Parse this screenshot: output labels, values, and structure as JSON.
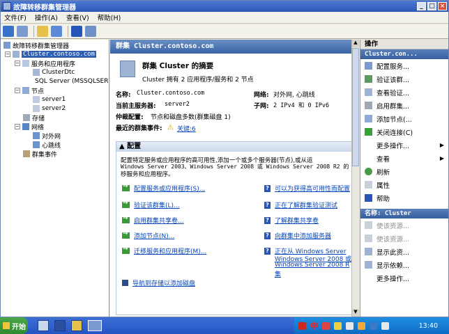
{
  "window": {
    "title": "故障转移群集管理器",
    "minimize": "_",
    "maximize": "□",
    "close": "×"
  },
  "menu": [
    "文件(F)",
    "操作(A)",
    "查看(V)",
    "帮助(H)"
  ],
  "tree": {
    "root": "故障转移群集管理器",
    "cluster": "Cluster.contoso.com",
    "services": "服务和应用程序",
    "svc1": "ClusterDtc",
    "svc2": "SQL Server (MSSQLSERVER)",
    "nodes": "节点",
    "node1": "server1",
    "node2": "server2",
    "storage": "存储",
    "networks": "网络",
    "net1": "对外网",
    "net2": "心跳线",
    "events": "群集事件"
  },
  "center": {
    "header": "群集 Cluster.contoso.com",
    "summary_title": "群集 Cluster 的摘要",
    "summary_desc": "Cluster 拥有 2 应用程序/服务和 2 节点",
    "name_label": "名称:",
    "name_value": "Cluster.contoso.com",
    "network_label": "网络:",
    "network_value": "对外网, 心跳线",
    "host_label": "当前主服务器:",
    "host_value": "server2",
    "subnet_label": "子网:",
    "subnet_value": "2 IPv4 和 0 IPv6",
    "quorum_label": "仲裁配置:",
    "quorum_value": "节点和磁盘多数(群集磁盘 1)",
    "events_label": "最近的群集事件:",
    "events_value": "关键:6",
    "config_header": "配置",
    "config_desc1": "配置特定服务或应用程序的高可用性,添加一个或多个服务器(节点),或从运",
    "config_desc2": "Windows Server 2003、Windows Server 2008 或 Windows Server 2008 R2 的",
    "config_desc3": "移服务和应用程序。",
    "left_links": [
      "配置服务或应用程序(S)...",
      "验证该群集(L)...",
      "启用群集共享卷...",
      "添加节点(N)...",
      "迁移服务和应用程序(M)...",
      "导航到存储以添加磁盘"
    ],
    "right_links": [
      "可以为获得高可用性而配置",
      "正在了解群集验证测试",
      "了解群集共享卷",
      "向群集中添加服务器",
      "正在从 Windows Server",
      "Windows Server 2008 或",
      "Windows Server 2008 R",
      "集"
    ]
  },
  "actions": {
    "header": "操作",
    "cluster_header": "Cluster.con...",
    "items": [
      "配置服务...",
      "验证该群...",
      "查看验证...",
      "启用群集...",
      "添加节点(...",
      "关闭连接(C)",
      "更多操作...",
      "查看",
      "刷新",
      "属性",
      "帮助"
    ],
    "name_header": "名称: Cluster",
    "items2": [
      "使该资源...",
      "使该资源...",
      "显示此资...",
      "显示依赖...",
      "更多操作..."
    ]
  },
  "taskbar": {
    "start": "开始",
    "ime": "中",
    "clock": "13:40"
  }
}
